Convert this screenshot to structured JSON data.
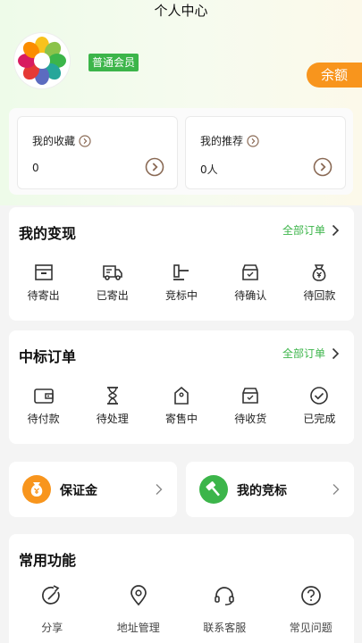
{
  "header": {
    "title": "个人中心"
  },
  "profile": {
    "member_badge": "普通会员",
    "balance_label": "余额"
  },
  "stats": [
    {
      "label": "我的收藏",
      "value": "0"
    },
    {
      "label": "我的推荐",
      "value": "0人"
    }
  ],
  "realize": {
    "title": "我的变现",
    "more": "全部订单",
    "items": [
      {
        "label": "待寄出",
        "icon": "box-icon"
      },
      {
        "label": "已寄出",
        "icon": "truck-icon"
      },
      {
        "label": "竞标中",
        "icon": "gavel-icon"
      },
      {
        "label": "待确认",
        "icon": "tray-check-icon"
      },
      {
        "label": "待回款",
        "icon": "money-bag-icon"
      }
    ]
  },
  "winning": {
    "title": "中标订单",
    "more": "全部订单",
    "items": [
      {
        "label": "待付款",
        "icon": "wallet-icon"
      },
      {
        "label": "待处理",
        "icon": "hourglass-icon"
      },
      {
        "label": "寄售中",
        "icon": "tag-icon"
      },
      {
        "label": "待收货",
        "icon": "tray-check-icon"
      },
      {
        "label": "已完成",
        "icon": "check-circle-icon"
      }
    ]
  },
  "quick": [
    {
      "label": "保证金",
      "icon": "money-bag-icon",
      "color": "#f8951d"
    },
    {
      "label": "我的竞标",
      "icon": "gavel-icon",
      "color": "#3cb54a"
    }
  ],
  "functions": {
    "title": "常用功能",
    "items": [
      {
        "label": "分享",
        "icon": "share-icon"
      },
      {
        "label": "地址管理",
        "icon": "location-icon"
      },
      {
        "label": "联系客服",
        "icon": "headset-icon"
      },
      {
        "label": "常见问题",
        "icon": "question-icon"
      }
    ]
  },
  "colors": {
    "accent_green": "#3cb54a",
    "accent_orange": "#f8951d",
    "arrow_brown": "#8a6a55"
  }
}
